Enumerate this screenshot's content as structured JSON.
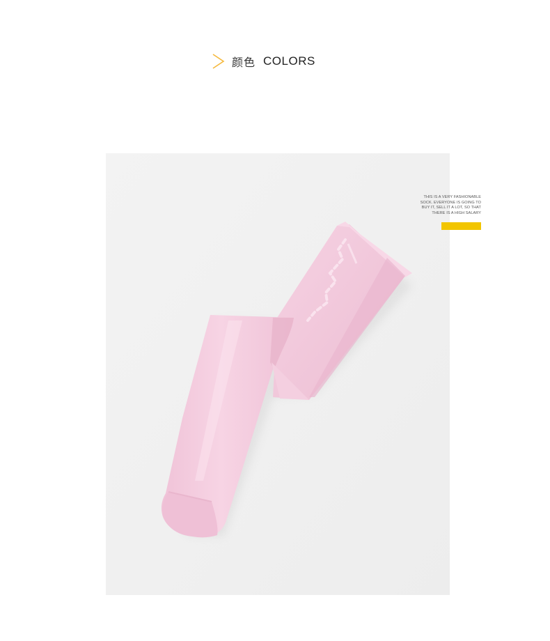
{
  "header": {
    "chevron_icon": "chevron-right-icon",
    "chevron_color": "#f5b83b",
    "title_cn": "颜色",
    "title_en": "COLORS"
  },
  "product_photo": {
    "subject": "pink-tights",
    "background_color": "#f1f1f1",
    "item_color": "#f4cde0"
  },
  "caption": {
    "lines": [
      "THIS IS A VERY FASHIONABLE",
      "SOCK. EVERYONE IS GOING TO",
      "BUY IT, SELL IT A LOT, SO THAT",
      "THERE IS A HIGH SALARY"
    ],
    "accent_color": "#f2c500"
  }
}
